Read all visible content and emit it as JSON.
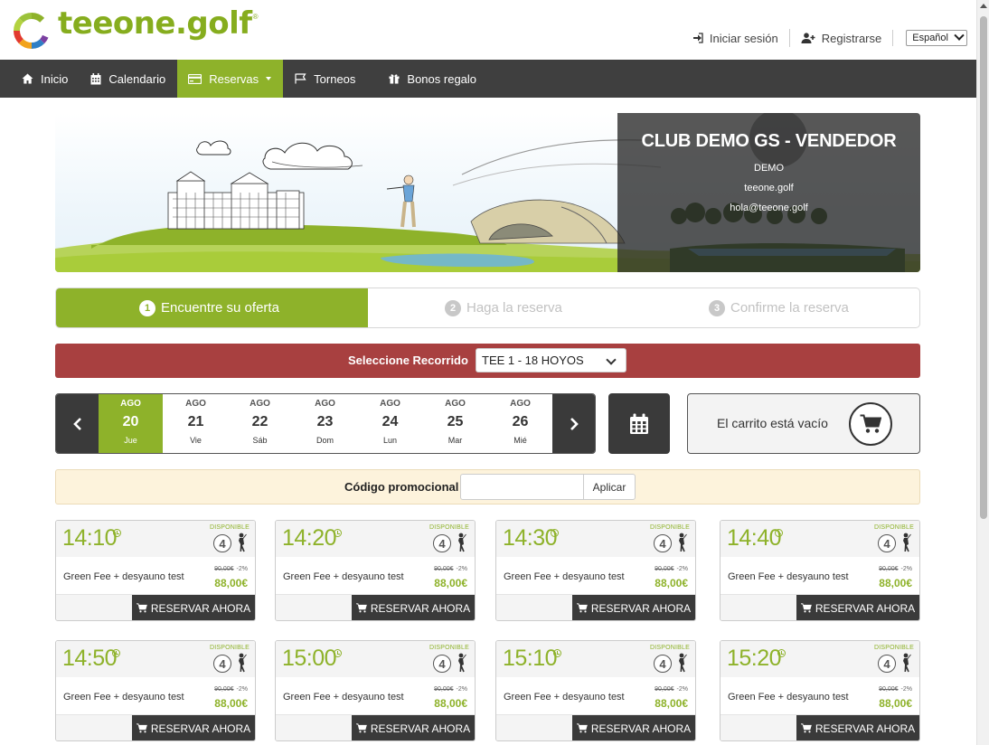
{
  "brand": {
    "name": "teeone.golf",
    "reg": "®",
    "green": "#8eb22a",
    "dark": "#3a3a3a",
    "red": "#a84040"
  },
  "header": {
    "login": "Iniciar sesión",
    "register": "Registrarse",
    "language": "Español"
  },
  "nav": {
    "items": [
      {
        "label": "Inicio",
        "icon": "home-icon"
      },
      {
        "label": "Calendario",
        "icon": "calendar-icon"
      },
      {
        "label": "Reservas",
        "icon": "credit-card-icon",
        "active": true
      },
      {
        "label": "Torneos",
        "icon": "flag-icon"
      },
      {
        "label": "Bonos regalo",
        "icon": "gift-icon"
      }
    ]
  },
  "club": {
    "name": "CLUB DEMO GS - VENDEDOR",
    "line1": "DEMO",
    "line2": "teeone.golf",
    "email": "hola@teeone.golf"
  },
  "steps": [
    {
      "num": "1",
      "label": "Encuentre su oferta"
    },
    {
      "num": "2",
      "label": "Haga la reserva"
    },
    {
      "num": "3",
      "label": "Confirme la reserva"
    }
  ],
  "course": {
    "label": "Seleccione Recorrido",
    "selected": "TEE 1 - 18 HOYOS"
  },
  "dates": [
    {
      "month": "AGO",
      "day": "20",
      "weekday": "Jue",
      "active": true
    },
    {
      "month": "AGO",
      "day": "21",
      "weekday": "Vie"
    },
    {
      "month": "AGO",
      "day": "22",
      "weekday": "Sáb"
    },
    {
      "month": "AGO",
      "day": "23",
      "weekday": "Dom"
    },
    {
      "month": "AGO",
      "day": "24",
      "weekday": "Lun"
    },
    {
      "month": "AGO",
      "day": "25",
      "weekday": "Mar"
    },
    {
      "month": "AGO",
      "day": "26",
      "weekday": "Mié"
    }
  ],
  "cart": {
    "text": "El carrito está vacío"
  },
  "promo": {
    "label": "Código promocional",
    "value": "",
    "apply": "Aplicar"
  },
  "slots": [
    {
      "time": "14:10",
      "status": "DISPONIBLE",
      "players": "4",
      "desc": "Green Fee + desyauno test",
      "old_price": "90,00€",
      "discount": "-2%",
      "price": "88,00€",
      "cta": "RESERVAR AHORA"
    },
    {
      "time": "14:20",
      "status": "DISPONIBLE",
      "players": "4",
      "desc": "Green Fee + desyauno test",
      "old_price": "90,00€",
      "discount": "-2%",
      "price": "88,00€",
      "cta": "RESERVAR AHORA"
    },
    {
      "time": "14:30",
      "status": "DISPONIBLE",
      "players": "4",
      "desc": "Green Fee + desyauno test",
      "old_price": "90,00€",
      "discount": "-2%",
      "price": "88,00€",
      "cta": "RESERVAR AHORA"
    },
    {
      "time": "14:40",
      "status": "DISPONIBLE",
      "players": "4",
      "desc": "Green Fee + desyauno test",
      "old_price": "90,00€",
      "discount": "-2%",
      "price": "88,00€",
      "cta": "RESERVAR AHORA"
    },
    {
      "time": "14:50",
      "status": "DISPONIBLE",
      "players": "4",
      "desc": "Green Fee + desyauno test",
      "old_price": "90,00€",
      "discount": "-2%",
      "price": "88,00€",
      "cta": "RESERVAR AHORA"
    },
    {
      "time": "15:00",
      "status": "DISPONIBLE",
      "players": "4",
      "desc": "Green Fee + desyauno test",
      "old_price": "90,00€",
      "discount": "-2%",
      "price": "88,00€",
      "cta": "RESERVAR AHORA"
    },
    {
      "time": "15:10",
      "status": "DISPONIBLE",
      "players": "4",
      "desc": "Green Fee + desyauno test",
      "old_price": "90,00€",
      "discount": "-2%",
      "price": "88,00€",
      "cta": "RESERVAR AHORA"
    },
    {
      "time": "15:20",
      "status": "DISPONIBLE",
      "players": "4",
      "desc": "Green Fee + desyauno test",
      "old_price": "90,00€",
      "discount": "-2%",
      "price": "88,00€",
      "cta": "RESERVAR AHORA"
    }
  ]
}
